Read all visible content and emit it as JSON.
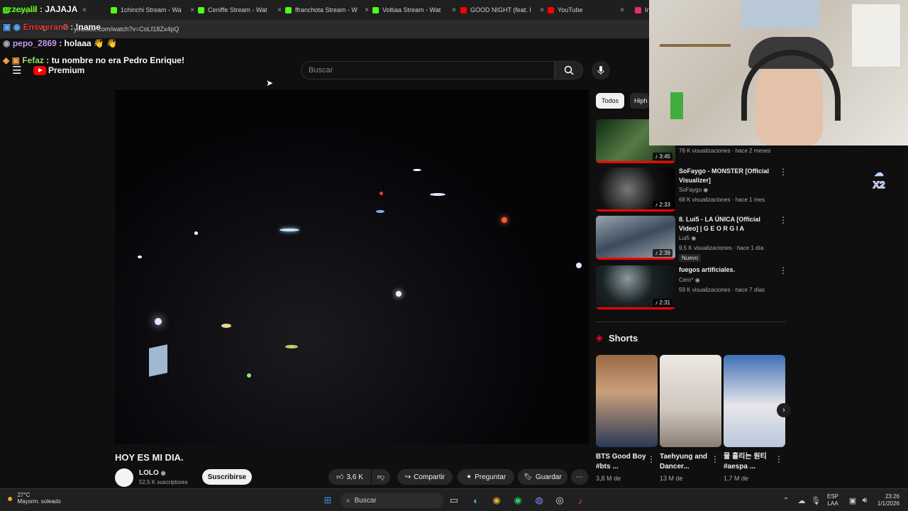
{
  "browser": {
    "tabs": [
      {
        "label": "ezzeyalll",
        "color": "#53fc18"
      },
      {
        "label": "1chinchi Stream - Wa",
        "color": "#53fc18"
      },
      {
        "label": "Ceniffe Stream - Wat",
        "color": "#53fc18"
      },
      {
        "label": "ffranchota Stream - W",
        "color": "#53fc18"
      },
      {
        "label": "Voltiaa Stream - Wat",
        "color": "#53fc18"
      },
      {
        "label": "GOOD NIGHT (feat. I",
        "color": "#ff0000"
      },
      {
        "label": "YouTube",
        "color": "#ff0000"
      },
      {
        "label": "In",
        "color": "#e1306c"
      }
    ],
    "url": "youtube.com/watch?v=CoLf18Zx4pQ"
  },
  "chat": [
    {
      "user": "ezzeyalll",
      "message": "JAJAJA",
      "color": "#53fc18"
    },
    {
      "user": "Ensweran2",
      "message": "!name",
      "color": "#e23b3b"
    },
    {
      "user": "pepo_2869",
      "message": "holaaa 👋 👋",
      "color": "#c79bf2"
    },
    {
      "user": "Fefaz",
      "message": "tu nombre no era Pedro Enrique!",
      "color": "#9be36b"
    }
  ],
  "youtube": {
    "logo": "Premium",
    "search_placeholder": "Buscar",
    "video_title": "HOY ES MI DIA.",
    "channel": "LOLO",
    "subscribers": "52,5 K suscriptores",
    "subscribe_label": "Suscribirse",
    "likes": "3,6 K",
    "share_label": "Compartir",
    "ask_label": "Preguntar",
    "save_label": "Guardar",
    "chips": [
      "Todos",
      "Hiph"
    ],
    "related": [
      {
        "title": "",
        "channel": "",
        "meta": "78 K visualizaciones · hace 2 meses",
        "duration": "3:45"
      },
      {
        "title": "SoFaygo - MONSTER [Official Visualizer]",
        "channel": "SoFaygo",
        "meta": "68 K visualizaciones · hace 1 mes",
        "duration": "2:33"
      },
      {
        "title": "8. Lui5 - LA ÚNICA [Official Video] | G E O R G I A",
        "channel": "Lui5",
        "meta": "9,5 K visualizaciones · hace 1 día",
        "badge": "Nuevo",
        "duration": "2:39"
      },
      {
        "title": "fuegos artificiales.",
        "channel": "Cero*",
        "meta": "59 K visualizaciones · hace 7 días",
        "duration": "2:31"
      }
    ],
    "shorts_label": "Shorts",
    "shorts": [
      {
        "title": "BTS Good Boy #bts ...",
        "views": "3,8 M de"
      },
      {
        "title": "Taehyung and Dancer...",
        "views": "13 M de"
      },
      {
        "title": "물 흘리는 원티 #aespa ...",
        "views": "1,7 M de"
      }
    ]
  },
  "webcam": {
    "overlay": "X2"
  },
  "taskbar": {
    "weather_temp": "27°C",
    "weather_desc": "Mayorm. soleado",
    "search_label": "Buscar",
    "lang": "ESP",
    "lang2": "LAA",
    "time": "23:26",
    "date": "1/1/2026"
  }
}
